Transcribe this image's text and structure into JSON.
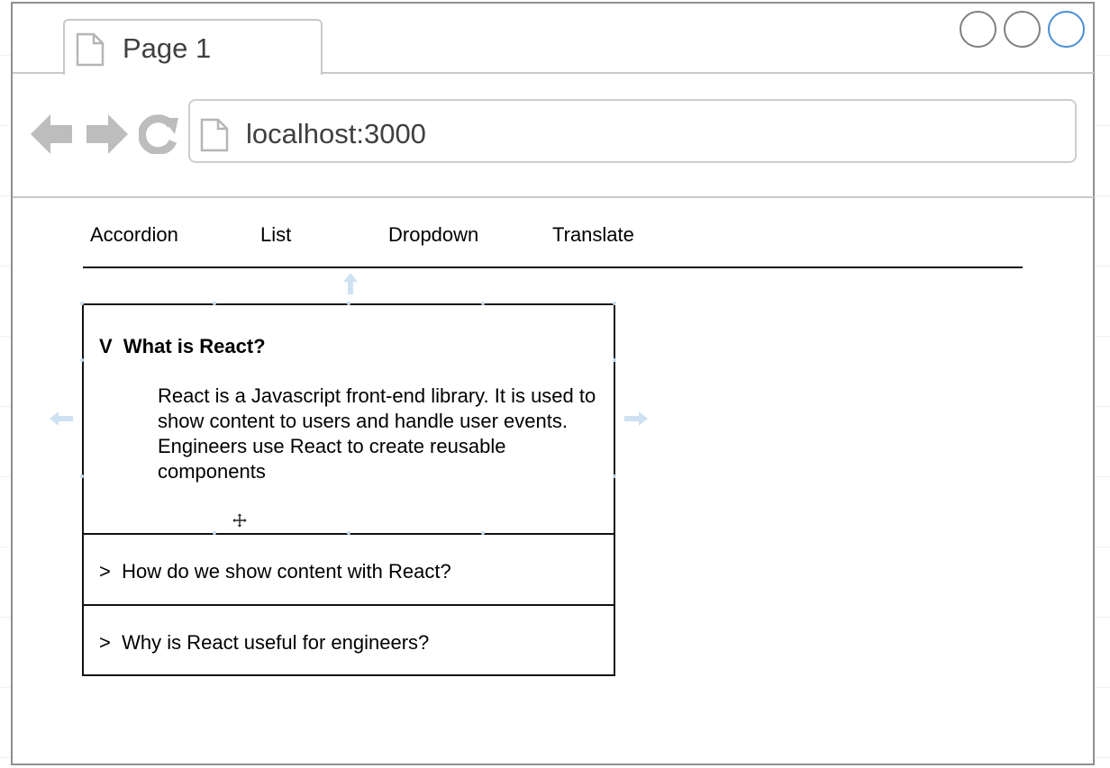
{
  "browser": {
    "tab_title": "Page 1",
    "address": "localhost:3000"
  },
  "nav": {
    "links": [
      "Accordion",
      "List",
      "Dropdown",
      "Translate"
    ]
  },
  "accordion": {
    "items": [
      {
        "indicator": "V",
        "title": "What is React?",
        "expanded": true,
        "content": [
          "React is a Javascript front-end library. It is used to show content to users and handle user events.",
          "Engineers use React to create reusable components"
        ]
      },
      {
        "indicator": ">",
        "title": "How do we show content with React?",
        "expanded": false
      },
      {
        "indicator": ">",
        "title": "Why is React useful for engineers?",
        "expanded": false
      }
    ]
  },
  "colors": {
    "frame": "#8f8f8f",
    "icon_gray": "#bdbdbd",
    "active_control": "#4a8fd6",
    "selection_hint": "#c7dcef"
  },
  "icons": {
    "back": "arrow-left-icon",
    "forward": "arrow-right-icon",
    "refresh": "refresh-icon",
    "page": "page-icon"
  }
}
